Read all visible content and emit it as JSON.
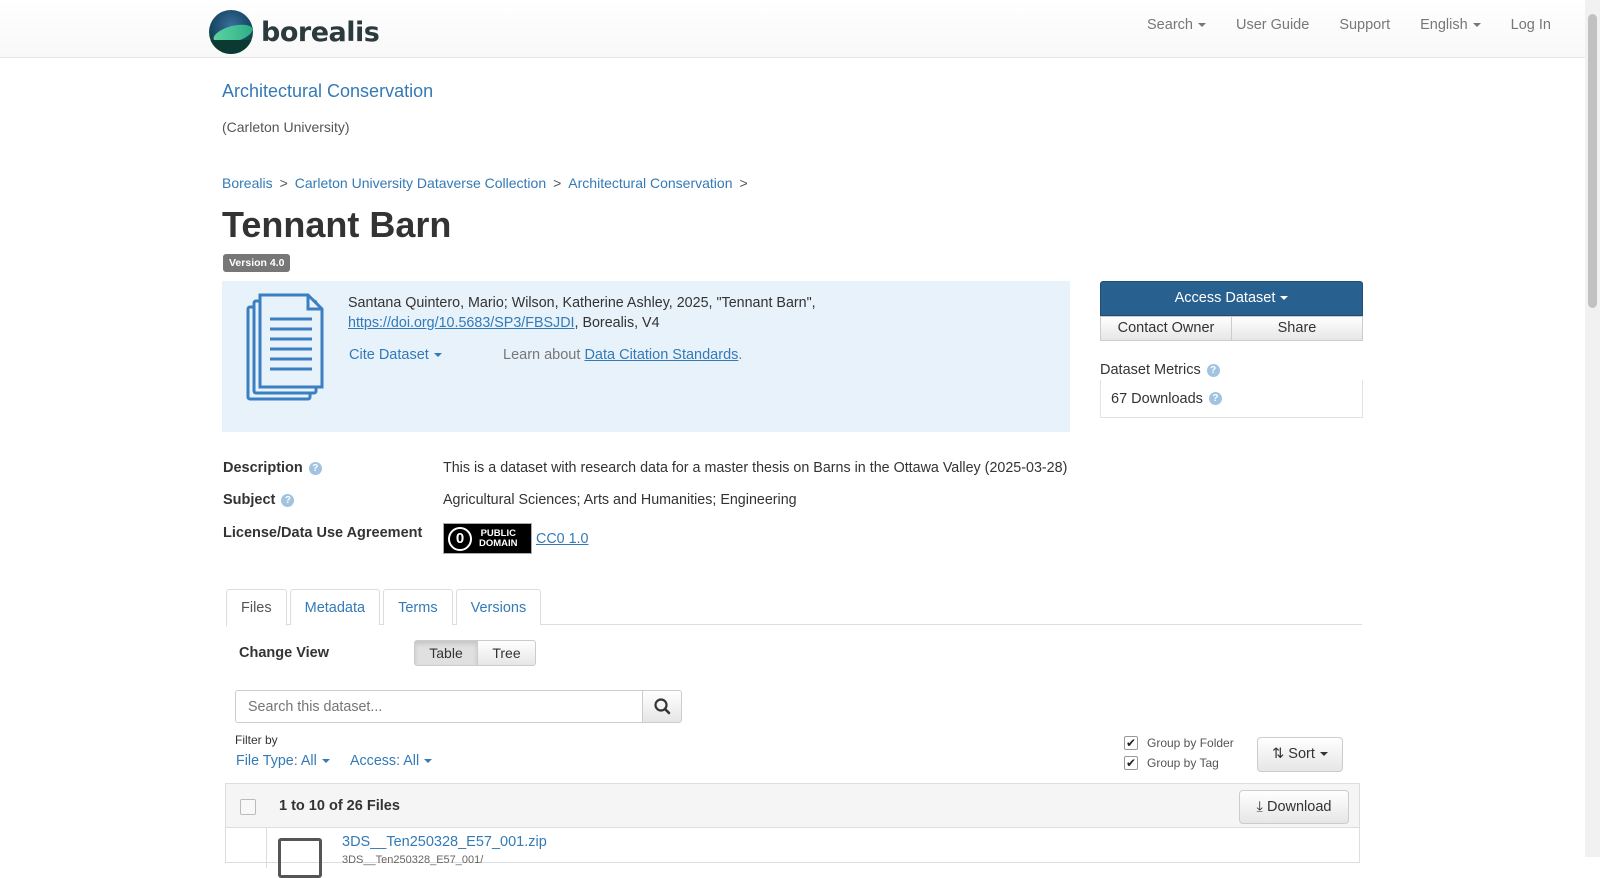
{
  "nav": {
    "brand": "borealis",
    "items": [
      "Search",
      "User Guide",
      "Support",
      "English",
      "Log In"
    ]
  },
  "dataverse": {
    "name": "Architectural Conservation",
    "affiliation": "(Carleton University)"
  },
  "breadcrumb": [
    "Borealis",
    "Carleton University Dataverse Collection",
    "Architectural Conservation"
  ],
  "breadcrumb_sep": ">",
  "dataset": {
    "title": "Tennant Barn",
    "version": "Version 4.0"
  },
  "citation": {
    "text": "Santana Quintero, Mario; Wilson, Katherine Ashley, 2025, \"Tennant Barn\",",
    "doi": "https://doi.org/10.5683/SP3/FBSJDI",
    "suffix": ", Borealis, V4",
    "cite_button": "Cite Dataset",
    "learn_prefix": "Learn about",
    "learn_link": "Data Citation Standards",
    "learn_suffix": "."
  },
  "actions": {
    "access": "Access Dataset",
    "contact": "Contact Owner",
    "share": "Share"
  },
  "metrics": {
    "heading": "Dataset Metrics",
    "downloads": "67 Downloads"
  },
  "metadata": {
    "description_label": "Description",
    "description": "This is a dataset with research data for a master thesis on Barns in the Ottawa Valley (2025-03-28)",
    "subject_label": "Subject",
    "subject": "Agricultural Sciences; Arts and Humanities; Engineering",
    "license_label": "License/Data Use Agreement",
    "license_badge_top": "PUBLIC",
    "license_badge_bottom": "DOMAIN",
    "license": "CC0 1.0"
  },
  "tabs": [
    "Files",
    "Metadata",
    "Terms",
    "Versions"
  ],
  "files": {
    "change_view": "Change View",
    "view_table": "Table",
    "view_tree": "Tree",
    "search_placeholder": "Search this dataset...",
    "filter_by": "Filter by",
    "filter_type": "File Type: All",
    "filter_access": "Access: All",
    "group_folder": "Group by Folder",
    "group_tag": "Group by Tag",
    "sort": "Sort",
    "count": "1 to 10 of 26 Files",
    "download": "Download",
    "rows": [
      {
        "name": "3DS__Ten250328_E57_001.zip",
        "path": "3DS__Ten250328_E57_001/"
      }
    ]
  },
  "colors": {
    "link": "#337ab7",
    "primary": "#286090",
    "citation_bg": "#e8f2fa"
  }
}
